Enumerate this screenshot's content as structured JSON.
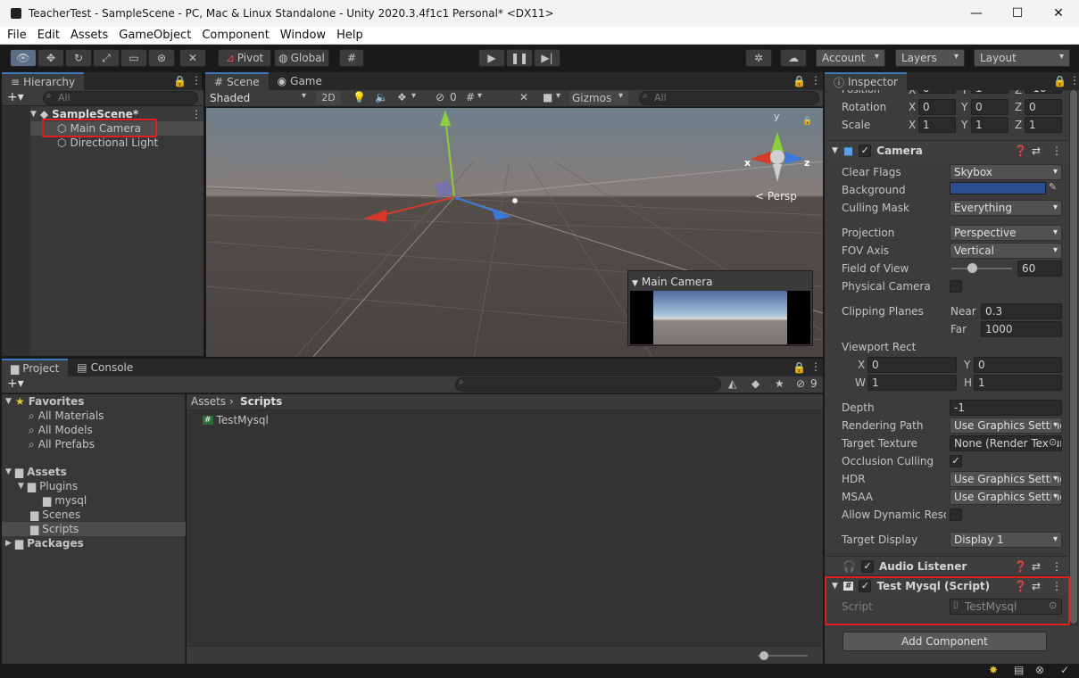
{
  "window": {
    "title": "TeacherTest - SampleScene - PC, Mac & Linux Standalone - Unity 2020.3.4f1c1 Personal* <DX11>",
    "minimize": "—",
    "maximize": "☐",
    "close": "✕"
  },
  "menu": [
    "File",
    "Edit",
    "Assets",
    "GameObject",
    "Component",
    "Window",
    "Help"
  ],
  "toolbar": {
    "pivot": "Pivot",
    "global": "Global",
    "account": "Account",
    "layers": "Layers",
    "layout": "Layout"
  },
  "hierarchy": {
    "tab": "Hierarchy",
    "search_placeholder": "All",
    "scene": "SampleScene*",
    "items": [
      "Main Camera",
      "Directional Light"
    ]
  },
  "scene": {
    "tabs": [
      "Scene",
      "Game"
    ],
    "shading": "Shaded",
    "mode2d": "2D",
    "hidden_count": "0",
    "gizmos": "Gizmos",
    "search_placeholder": "All",
    "persp": "Persp",
    "axis_x": "x",
    "axis_y": "y",
    "axis_z": "z",
    "preview_title": "Main Camera"
  },
  "project": {
    "tabs": [
      "Project",
      "Console"
    ],
    "hidden_count": "9",
    "favorites": "Favorites",
    "fav_items": [
      "All Materials",
      "All Models",
      "All Prefabs"
    ],
    "assets": "Assets",
    "asset_tree": {
      "plugins": "Plugins",
      "mysql": "mysql",
      "scenes": "Scenes",
      "scripts": "Scripts"
    },
    "packages": "Packages",
    "breadcrumb": [
      "Assets",
      "Scripts"
    ],
    "files": [
      "TestMysql"
    ]
  },
  "inspector": {
    "tab": "Inspector",
    "transform": {
      "position_label": "Position",
      "position": [
        "0",
        "1",
        "-10"
      ],
      "rotation_label": "Rotation",
      "rotation": [
        "0",
        "0",
        "0"
      ],
      "scale_label": "Scale",
      "scale": [
        "1",
        "1",
        "1"
      ],
      "axes": [
        "X",
        "Y",
        "Z"
      ]
    },
    "camera": {
      "title": "Camera",
      "clear_flags_label": "Clear Flags",
      "clear_flags": "Skybox",
      "background_label": "Background",
      "culling_mask_label": "Culling Mask",
      "culling_mask": "Everything",
      "projection_label": "Projection",
      "projection": "Perspective",
      "fov_axis_label": "FOV Axis",
      "fov_axis": "Vertical",
      "fov_label": "Field of View",
      "fov": "60",
      "physical_label": "Physical Camera",
      "clipping_label": "Clipping Planes",
      "near_label": "Near",
      "near": "0.3",
      "far_label": "Far",
      "far": "1000",
      "viewport_label": "Viewport Rect",
      "vx_label": "X",
      "vx": "0",
      "vy_label": "Y",
      "vy": "0",
      "vw_label": "W",
      "vw": "1",
      "vh_label": "H",
      "vh": "1",
      "depth_label": "Depth",
      "depth": "-1",
      "rendering_path_label": "Rendering Path",
      "rendering_path": "Use Graphics Settings",
      "target_texture_label": "Target Texture",
      "target_texture": "None (Render Texture)",
      "occlusion_label": "Occlusion Culling",
      "hdr_label": "HDR",
      "hdr": "Use Graphics Settings",
      "msaa_label": "MSAA",
      "msaa": "Use Graphics Settings",
      "dynres_label": "Allow Dynamic Resolution",
      "target_display_label": "Target Display",
      "target_display": "Display 1"
    },
    "audio_listener": {
      "title": "Audio Listener"
    },
    "script_comp": {
      "title": "Test Mysql (Script)",
      "script_label": "Script",
      "script_value": "TestMysql"
    },
    "add_component": "Add Component"
  },
  "colors": {
    "accent": "#3a79bb",
    "highlight": "#e0201f",
    "background_color": "#2b4e8c"
  }
}
